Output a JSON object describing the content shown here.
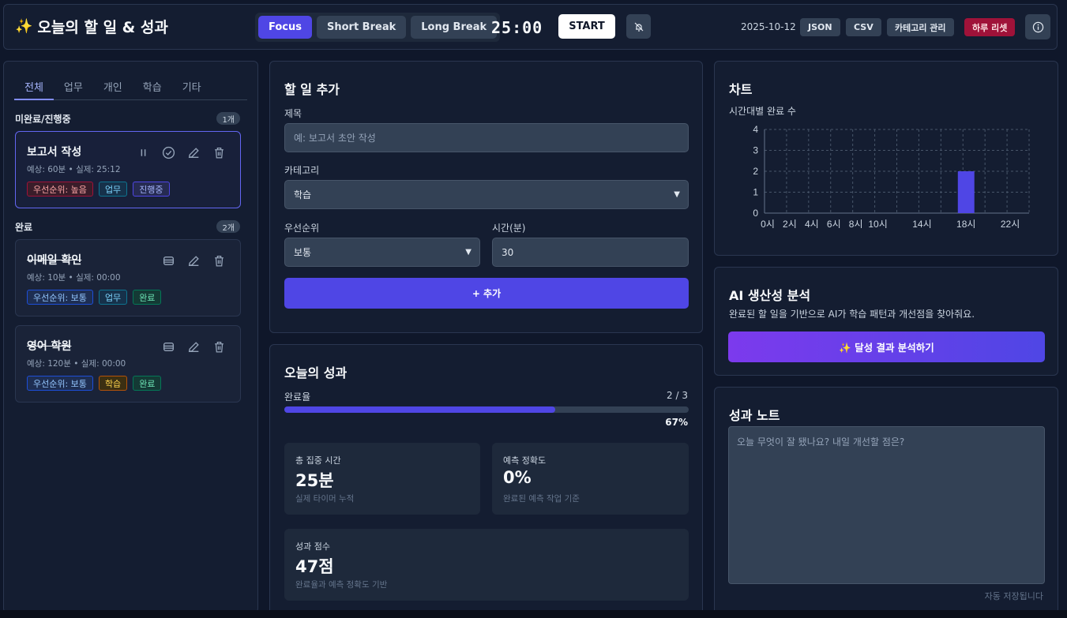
{
  "header": {
    "title": "오늘의 할 일 & 성과",
    "modes": [
      "Focus",
      "Short Break",
      "Long Break"
    ],
    "timer": "25:00",
    "start_label": "START",
    "date": "2025-10-12",
    "json_label": "JSON",
    "csv_label": "CSV",
    "category_label": "카테고리 관리",
    "reset_label": "하루 리셋"
  },
  "sidebar": {
    "tabs": [
      "전체",
      "업무",
      "개인",
      "학습",
      "기타"
    ],
    "pending_title": "미완료/진행중",
    "pending_count": "1개",
    "done_title": "완료",
    "done_count": "2개",
    "tasks": [
      {
        "title": "보고서 작성",
        "meta": "예상: 60분 • 실제: 25:12",
        "tags": [
          "우선순위: 높음",
          "업무",
          "진행중"
        ]
      },
      {
        "title": "이메일 확인",
        "meta": "예상: 10분 • 실제: 00:00",
        "tags": [
          "우선순위: 보통",
          "업무",
          "완료"
        ]
      },
      {
        "title": "영어 학원",
        "meta": "예상: 120분 • 실제: 00:00",
        "tags": [
          "우선순위: 보통",
          "학습",
          "완료"
        ]
      }
    ]
  },
  "add": {
    "title": "할 일 추가",
    "title_label": "제목",
    "title_placeholder": "예: 보고서 초안 작성",
    "category_label": "카테고리",
    "category_value": "학습",
    "priority_label": "우선순위",
    "priority_value": "보통",
    "time_label": "시간(분)",
    "time_value": "30",
    "add_button": "+ 추가"
  },
  "results": {
    "title": "오늘의 성과",
    "rate_label": "완료율",
    "rate_fraction": "2 / 3",
    "rate_percent": "67%",
    "rate_value": 0.67,
    "focus_label": "총 집중 시간",
    "focus_value": "25분",
    "focus_sub": "실제 타이머 누적",
    "accuracy_label": "예측 정확도",
    "accuracy_value": "0%",
    "accuracy_sub": "완료된 예측 작업 기준",
    "score_label": "성과 점수",
    "score_value": "47점",
    "score_sub": "완료율과 예측 정확도 기반"
  },
  "chart_panel": {
    "title": "차트"
  },
  "chart_data": {
    "type": "bar",
    "title": "시간대별 완료 수",
    "x": [
      0,
      2,
      4,
      6,
      8,
      10,
      12,
      14,
      16,
      18,
      20,
      22
    ],
    "x_tick_labels": [
      "0시",
      "2시",
      "4시",
      "6시",
      "8시",
      "10시",
      "14시",
      "18시",
      "22시"
    ],
    "x_tick_hours": [
      0,
      2,
      4,
      6,
      8,
      10,
      14,
      18,
      22
    ],
    "bars": [
      {
        "hour": 18,
        "value": 2
      }
    ],
    "ylim": [
      0,
      4
    ],
    "y_ticks": [
      "0",
      "1",
      "2",
      "3",
      "4"
    ],
    "grid": true,
    "bar_color": "#4f46e5"
  },
  "ai": {
    "title": "AI 생산성 분석",
    "desc": "완료된 할 일을 기반으로 AI가 학습 패턴과 개선점을 찾아줘요.",
    "button": "✨ 달성 결과 분석하기"
  },
  "notes": {
    "title": "성과 노트",
    "placeholder": "오늘 무엇이 잘 됐나요? 내일 개선할 점은?",
    "autosave": "자동 저장됩니다"
  }
}
